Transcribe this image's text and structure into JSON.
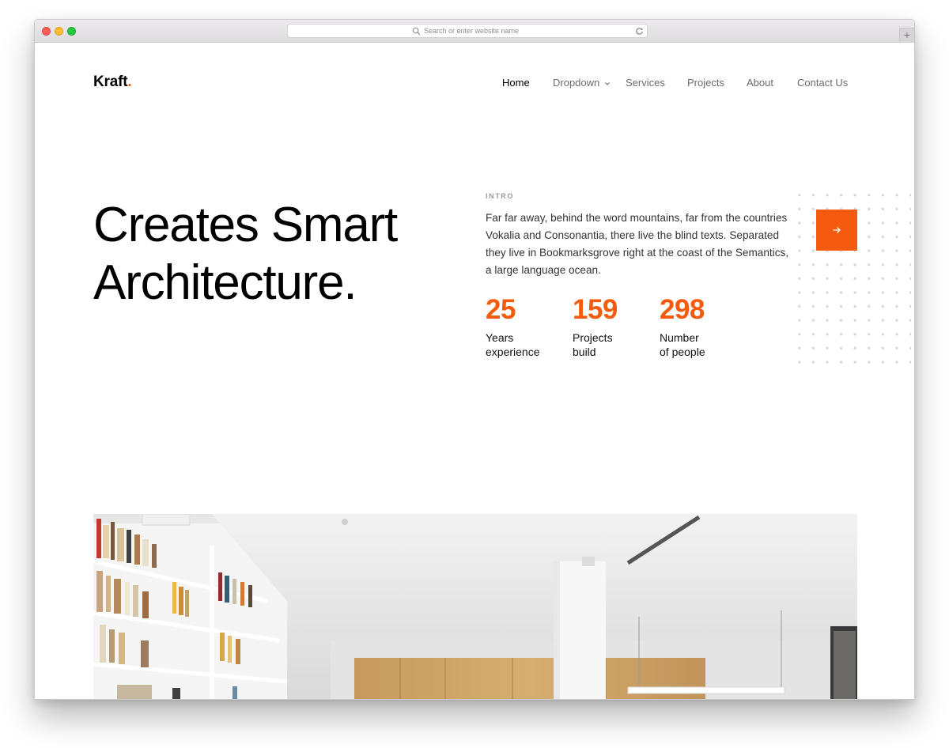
{
  "browser": {
    "url_placeholder": "Search or enter website name",
    "new_tab_label": "+"
  },
  "brand": {
    "name": "Kraft",
    "dot": ".",
    "accent_color": "#f45b0e"
  },
  "nav": {
    "items": [
      {
        "label": "Home",
        "active": true
      },
      {
        "label": "Dropdown",
        "has_dropdown": true
      },
      {
        "label": "Services"
      },
      {
        "label": "Projects"
      },
      {
        "label": "About"
      },
      {
        "label": "Contact Us"
      }
    ]
  },
  "hero": {
    "title_line1": "Creates Smart",
    "title_line2": "Architecture."
  },
  "intro": {
    "label": "INTRO",
    "text": "Far far away, behind the word mountains, far from the countries Vokalia and Consonantia, there live the blind texts. Separated they live in Bookmarksgrove right at the coast of the Semantics, a large language ocean.",
    "arrow_icon": "arrow-right-icon"
  },
  "stats": [
    {
      "value": "25",
      "label_line1": "Years",
      "label_line2": "experience"
    },
    {
      "value": "159",
      "label_line1": "Projects",
      "label_line2": "build"
    },
    {
      "value": "298",
      "label_line1": "Number",
      "label_line2": "of people"
    }
  ],
  "icons": {
    "search": "search-icon",
    "reload": "reload-icon",
    "dropdown": "chevron-down-icon"
  }
}
